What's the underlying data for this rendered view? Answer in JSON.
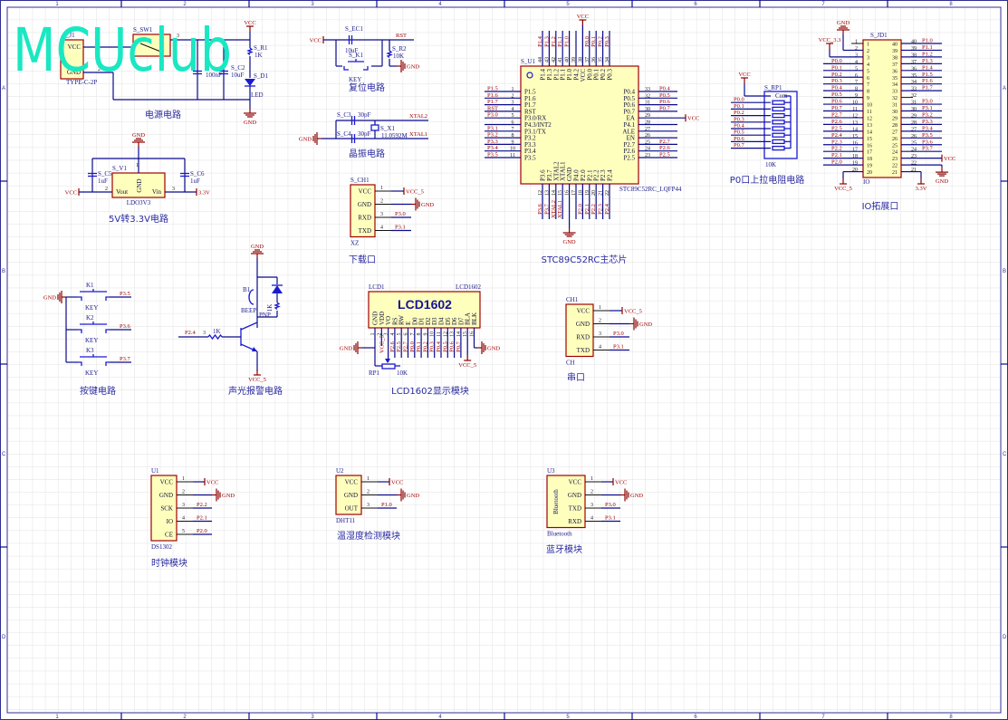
{
  "frame": {
    "columns": [
      "1",
      "2",
      "3",
      "4",
      "5",
      "6",
      "7",
      "8"
    ],
    "rows": [
      "A",
      "B",
      "C",
      "D"
    ]
  },
  "watermark": "MCUclub",
  "power": {
    "caption": "电源电路",
    "usb": {
      "designator": "S_J1",
      "part": "TYPE-C-2P",
      "pins": [
        "VCC",
        "GND"
      ],
      "pin_numbers": [
        "1",
        "2"
      ]
    },
    "switch": {
      "designator": "S_SW1",
      "pin": "3"
    },
    "c1": {
      "value": "100nF"
    },
    "c2": {
      "designator": "S_C2",
      "value": "10uF"
    },
    "r1": {
      "designator": "S_R1",
      "value": "1K"
    },
    "d1": {
      "designator": "S_D1",
      "value": "LED"
    },
    "vcc": "VCC",
    "gnd": "GND"
  },
  "reset": {
    "caption": "复位电路",
    "vcc": "VCC",
    "ec1": {
      "designator": "S_EC1",
      "value": "10uF"
    },
    "r2": {
      "designator": "S_R2",
      "value": "10K"
    },
    "k1": {
      "designator": "S_K1",
      "value": "KEY"
    },
    "rst": "RST",
    "gnd": "GND"
  },
  "crystal": {
    "caption": "晶振电路",
    "c3": {
      "designator": "S_C3",
      "value": "30pF"
    },
    "c4": {
      "designator": "S_C4",
      "value": "30pF"
    },
    "x1": {
      "designator": "S_X1",
      "value": "11.0592M"
    },
    "xtal2": "XTAL2",
    "xtal1": "XTAL1",
    "gnd": "GND"
  },
  "ldo": {
    "caption": "5V转3.3V电路",
    "designator": "S_V1",
    "part": "LDO3V3",
    "pins": [
      "GND",
      "Vout",
      "Vin"
    ],
    "pin_numbers": [
      "1",
      "2",
      "3"
    ],
    "c5": {
      "designator": "S_C5",
      "value": "1uF"
    },
    "c6": {
      "designator": "S_C6",
      "value": "1uF"
    },
    "vcc": "VCC",
    "out": "3.3V",
    "gnd": "GND"
  },
  "modules": {
    "download": {
      "caption": "下载口",
      "designator": "S_CH1",
      "footprint": "XZ",
      "pins": [
        "VCC",
        "GND",
        "RXD",
        "TXD"
      ],
      "numbers": [
        "1",
        "2",
        "3",
        "4"
      ],
      "nets": [
        "VCC_5",
        "GND",
        "P3.0",
        "P3.1"
      ]
    },
    "serial": {
      "caption": "串口",
      "designator": "CH1",
      "footprint": "CH",
      "pins": [
        "VCC",
        "GND",
        "RXD",
        "TXD"
      ],
      "numbers": [
        "1",
        "2",
        "3",
        "4"
      ],
      "nets": [
        "VCC_5",
        "GND",
        "P3.0",
        "P3.1"
      ]
    },
    "clock": {
      "caption": "时钟模块",
      "designator": "U1",
      "footprint": "DS1302",
      "pins": [
        "VCC",
        "GND",
        "SCK",
        "IO",
        "CE"
      ],
      "numbers": [
        "1",
        "2",
        "3",
        "4",
        "5"
      ],
      "nets": [
        "VCC",
        "GND",
        "P2.2",
        "P2.1",
        "P2.0"
      ]
    },
    "dht": {
      "caption": "温湿度检测模块",
      "designator": "U2",
      "footprint": "DHT11",
      "pins": [
        "VCC",
        "GND",
        "OUT"
      ],
      "numbers": [
        "1",
        "2",
        "3"
      ],
      "nets": [
        "VCC",
        "GND",
        "P1.0"
      ]
    },
    "bluetooth": {
      "caption": "蓝牙模块",
      "designator": "U3",
      "footprint": "Bluetooth",
      "body_label": "Bluetooth",
      "pins": [
        "VCC",
        "GND",
        "TXD",
        "RXD"
      ],
      "numbers": [
        "1",
        "2",
        "3",
        "4"
      ],
      "nets": [
        "VCC",
        "GND",
        "P3.0",
        "P3.1"
      ]
    }
  },
  "mcu": {
    "caption": "STC89C52RC主芯片",
    "designator": "S_U1",
    "part": "STC89C52RC_LQFP44",
    "left": [
      {
        "num": "1",
        "name": "P1.5",
        "net": "P1.5"
      },
      {
        "num": "2",
        "name": "P1.6",
        "net": "P1.6"
      },
      {
        "num": "3",
        "name": "P1.7",
        "net": "P1.7"
      },
      {
        "num": "4",
        "name": "RST",
        "net": "RST"
      },
      {
        "num": "5",
        "name": "P3.0/RX",
        "net": "P3.0"
      },
      {
        "num": "6",
        "name": "P4.3/INT2",
        "net": ""
      },
      {
        "num": "7",
        "name": "P3.1/TX",
        "net": "P3.1"
      },
      {
        "num": "8",
        "name": "P3.2",
        "net": "P3.2"
      },
      {
        "num": "9",
        "name": "P3.3",
        "net": "P3.3"
      },
      {
        "num": "10",
        "name": "P3.4",
        "net": "P3.4"
      },
      {
        "num": "11",
        "name": "P3.5",
        "net": "P3.5"
      }
    ],
    "right": [
      {
        "num": "33",
        "name": "P0.4",
        "net": "P0.4"
      },
      {
        "num": "32",
        "name": "P0.5",
        "net": "P0.5"
      },
      {
        "num": "31",
        "name": "P0.6",
        "net": "P0.6"
      },
      {
        "num": "30",
        "name": "P0.7",
        "net": "P0.7"
      },
      {
        "num": "29",
        "name": "EA",
        "net": "VCC"
      },
      {
        "num": "28",
        "name": "P4.1",
        "net": ""
      },
      {
        "num": "27",
        "name": "ALE",
        "net": ""
      },
      {
        "num": "26",
        "name": "EN",
        "net": ""
      },
      {
        "num": "25",
        "name": "P2.7",
        "net": "P2.7"
      },
      {
        "num": "24",
        "name": "P2.6",
        "net": "P2.6"
      },
      {
        "num": "23",
        "name": "P2.5",
        "net": "P2.5"
      }
    ],
    "top": [
      {
        "num": "44",
        "name": "P1.4",
        "net": "P1.4"
      },
      {
        "num": "43",
        "name": "P1.3",
        "net": "P1.3"
      },
      {
        "num": "42",
        "name": "P1.2",
        "net": "P1.2"
      },
      {
        "num": "41",
        "name": "P1.1",
        "net": "P1.1"
      },
      {
        "num": "40",
        "name": "P1.0",
        "net": "P1.0"
      },
      {
        "num": "39",
        "name": "P4.2",
        "net": ""
      },
      {
        "num": "38",
        "name": "VCC",
        "net": "VCC"
      },
      {
        "num": "37",
        "name": "P0.0",
        "net": "P0.0"
      },
      {
        "num": "36",
        "name": "P0.1",
        "net": "P0.1"
      },
      {
        "num": "35",
        "name": "P0.2",
        "net": "P0.2"
      },
      {
        "num": "34",
        "name": "P0.3",
        "net": "P0.3"
      }
    ],
    "bottom": [
      {
        "num": "12",
        "name": "P3.6",
        "net": "P3.6"
      },
      {
        "num": "13",
        "name": "P3.7",
        "net": "P3.7"
      },
      {
        "num": "14",
        "name": "XTAL2",
        "net": "XTAL2"
      },
      {
        "num": "15",
        "name": "XTAL1",
        "net": "XTAL1"
      },
      {
        "num": "16",
        "name": "GND",
        "net": "GND"
      },
      {
        "num": "17",
        "name": "P4.0",
        "net": ""
      },
      {
        "num": "18",
        "name": "P2.0",
        "net": "P2.0"
      },
      {
        "num": "19",
        "name": "P2.1",
        "net": "P2.1"
      },
      {
        "num": "20",
        "name": "P2.2",
        "net": "P2.2"
      },
      {
        "num": "21",
        "name": "P2.3",
        "net": "P2.3"
      },
      {
        "num": "22",
        "name": "P2.4",
        "net": "P2.4"
      }
    ]
  },
  "pullup": {
    "caption": "P0口上拉电阻电路",
    "designator": "S_RP1",
    "value": "10K",
    "vcc": "VCC",
    "common": "Com",
    "nets": [
      "P0.0",
      "P0.1",
      "P0.2",
      "P0.3",
      "P0.4",
      "P0.5",
      "P0.6",
      "P0.7"
    ]
  },
  "io": {
    "caption": "IO拓展口",
    "designator": "S_JD1",
    "footprint": "IO",
    "left_numbers": [
      "1",
      "2",
      "3",
      "4",
      "5",
      "6",
      "7",
      "8",
      "9",
      "10",
      "11",
      "12",
      "13",
      "14",
      "15",
      "16",
      "17",
      "18",
      "19",
      "20"
    ],
    "right_numbers": [
      "40",
      "39",
      "38",
      "37",
      "36",
      "35",
      "34",
      "33",
      "32",
      "31",
      "30",
      "29",
      "28",
      "27",
      "26",
      "25",
      "24",
      "23",
      "22",
      "21"
    ],
    "left_nets": [
      "",
      "GND",
      "VCC_3.3",
      "P0.0",
      "P0.1",
      "P0.2",
      "P0.3",
      "P0.4",
      "P0.5",
      "P0.6",
      "P0.7",
      "P2.7",
      "P2.6",
      "P2.5",
      "P2.4",
      "P2.3",
      "P2.2",
      "P2.1",
      "P2.0",
      "VCC_5"
    ],
    "right_nets": [
      "P1.0",
      "P1.1",
      "P1.2",
      "P1.3",
      "P1.4",
      "P1.5",
      "P1.6",
      "P1.7",
      "",
      "P3.0",
      "P3.1",
      "P3.2",
      "P3.3",
      "P3.4",
      "P3.5",
      "P3.6",
      "P3.7",
      "VCC",
      "GND",
      "3.3V"
    ]
  },
  "keys": {
    "caption": "按键电路",
    "gnd": "GND",
    "items": [
      {
        "designator": "K1",
        "value": "KEY",
        "net": "P3.5"
      },
      {
        "designator": "K2",
        "value": "KEY",
        "net": "P3.6"
      },
      {
        "designator": "K3",
        "value": "KEY",
        "net": "P3.7"
      }
    ]
  },
  "buzzer": {
    "caption": "声光报警电路",
    "gnd": "GND",
    "b1": {
      "designator": "B1",
      "value": "BEEP"
    },
    "r_led": "1K",
    "r_base": "1K",
    "base_pin": "3",
    "input": "P2.4",
    "transistor": "PNP",
    "vcc": "VCC_5"
  },
  "lcd": {
    "caption": "LCD1602显示模块",
    "designator": "LCD1",
    "part": "LCD1602",
    "title": "LCD1602",
    "pins": [
      "GND",
      "VDD",
      "VO",
      "RS",
      "RW",
      "E",
      "D0",
      "D1",
      "D2",
      "D3",
      "D4",
      "D5",
      "D6",
      "D7",
      "BLA",
      "BLK"
    ],
    "numbers": [
      "1",
      "2",
      "3",
      "4",
      "5",
      "6",
      "7",
      "8",
      "9",
      "10",
      "11",
      "12",
      "13",
      "14",
      "15",
      "16"
    ],
    "nets": [
      "GND",
      "VCC_5",
      "",
      "P2.6",
      "P2.5",
      "P2.7",
      "P0.0",
      "P0.1",
      "P0.2",
      "P0.3",
      "P0.4",
      "P0.5",
      "P0.6",
      "P0.7",
      "VCC_5",
      "GND"
    ],
    "pot": {
      "designator": "RP1",
      "value": "10K"
    }
  },
  "colors": {
    "wire": "#0a0a8c",
    "power": "#8b0000",
    "component_fill": "#ffffbd",
    "component_border": "#a00000",
    "watermark": "#19e8c2"
  }
}
